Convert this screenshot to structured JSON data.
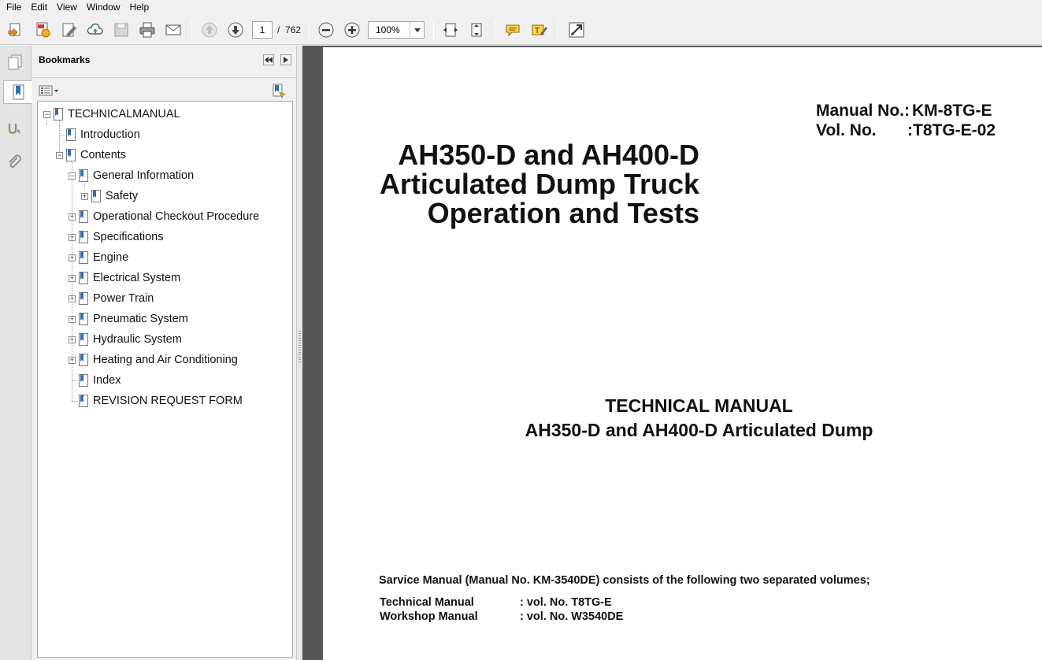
{
  "menu": {
    "items": [
      "File",
      "Edit",
      "View",
      "Window",
      "Help"
    ]
  },
  "toolbar": {
    "page_current": "1",
    "page_separator": "/",
    "page_total": "762",
    "zoom": "100%"
  },
  "rail": {
    "icons": [
      "pages-icon",
      "bookmarks-icon",
      "signatures-icon",
      "attachments-icon"
    ]
  },
  "bookmarks": {
    "title": "Bookmarks",
    "items": [
      {
        "label": "TECHNICALMANUAL",
        "expanded": true
      },
      {
        "label": "Introduction"
      },
      {
        "label": "Contents",
        "expanded": true
      },
      {
        "label": "General Information",
        "expanded": true
      },
      {
        "label": "Safety",
        "expanded": false
      },
      {
        "label": "Operational Checkout Procedure",
        "expanded": false
      },
      {
        "label": "Specifications",
        "expanded": false
      },
      {
        "label": "Engine",
        "expanded": false
      },
      {
        "label": "Electrical System",
        "expanded": false
      },
      {
        "label": "Power Train",
        "expanded": false
      },
      {
        "label": "Pneumatic System",
        "expanded": false
      },
      {
        "label": "Hydraulic System",
        "expanded": false
      },
      {
        "label": "Heating and Air Conditioning",
        "expanded": false
      },
      {
        "label": "Index"
      },
      {
        "label": "REVISION REQUEST FORM"
      }
    ]
  },
  "document": {
    "manual_no_label": "Manual No.:",
    "manual_no_value": "KM-8TG-E",
    "vol_no_label": "Vol. No.",
    "vol_no_value": ":T8TG-E-02",
    "title_line1": "AH350-D and AH400-D",
    "title_line2": "Articulated Dump Truck",
    "title_line3": "Operation and Tests",
    "subtitle_line1": "TECHNICAL MANUAL",
    "subtitle_line2": "AH350-D and AH400-D Articulated Dump",
    "service_note": "Sarvice Manual (Manual No. KM-3540DE) consists of the following two separated volumes;",
    "volumes": [
      {
        "name": "Technical Manual",
        "ref": ": vol. No. T8TG-E"
      },
      {
        "name": "Workshop Manual",
        "ref": ": vol. No. W3540DE"
      }
    ]
  },
  "colors": {
    "doc_background": "#525659",
    "accent_blue": "#2f6db5"
  }
}
